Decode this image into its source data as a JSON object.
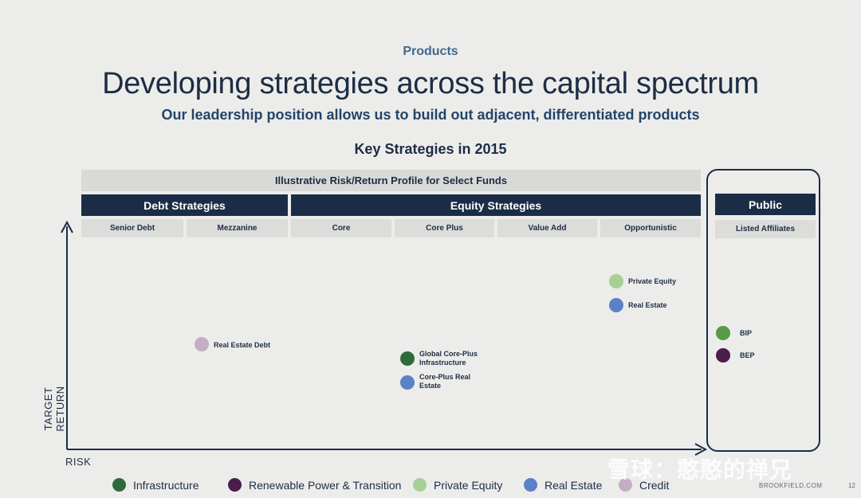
{
  "header": {
    "eyebrow": "Products",
    "title": "Developing strategies across the capital spectrum",
    "subtitle": "Our leadership position allows us to build out adjacent, differentiated products",
    "section_title": "Key Strategies in 2015"
  },
  "chart": {
    "banner": "Illustrative Risk/Return Profile for Select Funds",
    "groups": {
      "debt": "Debt Strategies",
      "equity": "Equity Strategies",
      "public": "Public"
    },
    "columns": [
      "Senior Debt",
      "Mezzanine",
      "Core",
      "Core Plus",
      "Value Add",
      "Opportunistic"
    ],
    "public_column": "Listed Affiliates",
    "y_axis_label": "TARGET RETURN",
    "x_axis_label": "RISK"
  },
  "points": {
    "real_estate_debt": "Real Estate Debt",
    "global_core_plus_infra": [
      "Global Core-Plus",
      "Infrastructure"
    ],
    "core_plus_real_estate": [
      "Core-Plus Real",
      "Estate"
    ],
    "private_equity": "Private Equity",
    "real_estate": "Real Estate",
    "bip": "BIP",
    "bep": "BEP"
  },
  "legend": [
    {
      "label": "Infrastructure",
      "color": "#2f6b3a"
    },
    {
      "label": "Renewable Power & Transition",
      "color": "#4a1d4a"
    },
    {
      "label": "Private Equity",
      "color": "#a8cf94"
    },
    {
      "label": "Real Estate",
      "color": "#5b82c6"
    },
    {
      "label": "Credit",
      "color": "#c3aec6"
    }
  ],
  "colors": {
    "infrastructure": "#2f6b3a",
    "infrastructure_public": "#5a9a47",
    "renewable": "#4a1d4a",
    "private_equity": "#a8cf94",
    "real_estate": "#5b82c6",
    "credit": "#c3aec6",
    "navy": "#1b2d46"
  },
  "footer": {
    "watermark": "雪球：憨憨的禅兄",
    "brand": "BROOKFIELD.COM",
    "page": "12"
  }
}
